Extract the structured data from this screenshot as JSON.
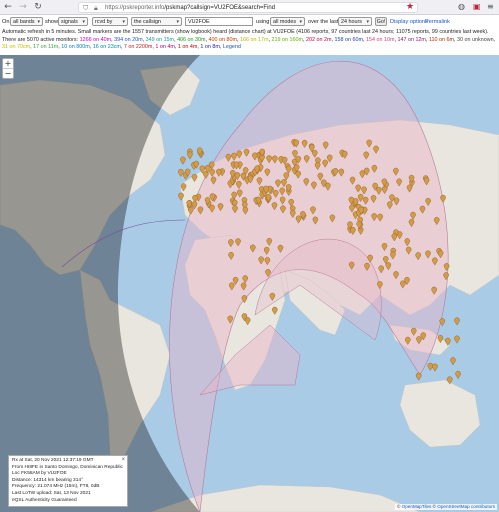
{
  "browser": {
    "url_host": "https://pskreporter.info",
    "url_path": "/pskmap?callsign=VU2FOE&search=Find",
    "back_icon": "arrow-left-icon",
    "forward_icon": "arrow-right-icon",
    "reload_icon": "reload-icon"
  },
  "controls": {
    "on_label": "On",
    "bands_value": "all bands",
    "show_label": "show",
    "show_value": "signals",
    "rcvd_value": "rcvd by",
    "callsign_mode": "the callsign",
    "callsign_value": "VU2FOE",
    "using_label": "using",
    "modes_value": "all modes",
    "over_label": "over the last",
    "period_value": "24 hours",
    "go_label": "Go!",
    "display_options": "Display options",
    "permalink": "Permalink"
  },
  "info": {
    "line1": "Automatic refresh in 5 minutes. Small markers are the 1557 transmitters (show logbook) heard (distance chart) at VU2FOE (4106 reports, 97 countries last 24 hours; 11075 reports, 99 countries last week).",
    "line2_prefix": "There are 5070 active monitors:",
    "bands": [
      {
        "text": "1266 on 40m",
        "color": "#c000c0"
      },
      {
        "text": "394 on 20m",
        "color": "#1a56c4"
      },
      {
        "text": "349 on 15m",
        "color": "#1a9a9a"
      },
      {
        "text": "406 on 30m",
        "color": "#1a9a1a"
      },
      {
        "text": "400 on 80m",
        "color": "#c04000"
      },
      {
        "text": "166 on 17m",
        "color": "#b8b800"
      },
      {
        "text": "219 on 160m",
        "color": "#60b000"
      },
      {
        "text": "202 on 2m",
        "color": "#c00040"
      },
      {
        "text": "158 on 60m",
        "color": "#2244aa"
      },
      {
        "text": "154 on 10m",
        "color": "#d04080"
      },
      {
        "text": "147 on 12m",
        "color": "#8a1a6a"
      },
      {
        "text": "110 on 6m",
        "color": "#a03000"
      },
      {
        "text": "30 on unknown",
        "color": "#444444"
      },
      {
        "text": "31 on 70cm",
        "color": "#c0c000"
      },
      {
        "text": "17 on 11m",
        "color": "#40a040"
      },
      {
        "text": "10 on 800m",
        "color": "#0080c0"
      },
      {
        "text": "16 on 23cm",
        "color": "#0088aa"
      },
      {
        "text": "7 on 2200m",
        "color": "#c02020"
      },
      {
        "text": "1 on 4m",
        "color": "#a00080"
      },
      {
        "text": "1 on 4m",
        "color": "#c00000"
      },
      {
        "text": "1 on 8m",
        "color": "#1a1aa0"
      },
      {
        "text": "Legend",
        "color": "#1a56c4"
      }
    ]
  },
  "map": {
    "zoom_in": "+",
    "zoom_out": "−",
    "attribution_prefix": "© ",
    "attribution_tiles": "OpenMapTiles",
    "attribution_sep": " © ",
    "attribution_osm": "OpenStreetMap contributors"
  },
  "popup": {
    "close": "×",
    "line1": "Rx at Sat, 20 Nov 2021 12:37:19 GMT",
    "line2": "From HI8FE in Santo Domingo, Dominican Republic",
    "line3": "Loc FK58AM by VU2FOE",
    "line4": "Distance: 14314 km bearing 314°",
    "line5": "Frequency: 21.074 MHz (15m), FT8, 0dB",
    "line6": "Last LoTW upload: Sat, 13 Nov 2021",
    "line7": "eQSL Authenticity Guaranteed"
  },
  "colors": {
    "ocean": "#a9cbe6",
    "land": "#e9e6df",
    "night_shade": "rgba(0,0,0,0.35)",
    "range_fill": "rgba(232,180,200,0.55)",
    "marker": "#d49a45"
  }
}
